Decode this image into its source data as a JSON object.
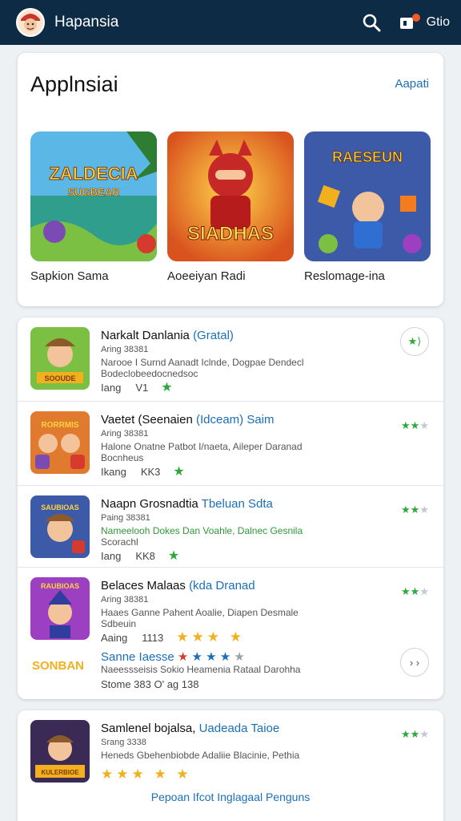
{
  "header": {
    "title": "Hapansia",
    "action_label": "Gtio"
  },
  "featured": {
    "title": "Applnsiai",
    "link": "Aapati",
    "items": [
      {
        "label": "Sapkion Sama",
        "art": "ZALDECIA SUGBEAR"
      },
      {
        "label": "Aoeeiyan Radi",
        "art": "SIADHAS"
      },
      {
        "label": "Reslomage-ina",
        "art": "RAESEUN"
      }
    ]
  },
  "list": {
    "rows": [
      {
        "title": "Narkalt Danlania",
        "accent": "(Gratal)",
        "meta": "Aring 38381",
        "desc1": "Narooe I Surnd Aanadt Iclnde, Dogpae Dendecl",
        "desc2": "Bodeclobeedocnedsoc",
        "foot1": "Iang",
        "foot2": "V1",
        "rating": "★",
        "icon": "SOOUDE"
      },
      {
        "title": "Vaetet (Seenaien",
        "accent": "(Idceam) Saim",
        "meta": "Aring 38381",
        "desc1": "Halone Onatne Patbot I/naeta, Aileper Daranad",
        "desc2": "Bocnheus",
        "foot1": "Ikang",
        "foot2": "KK3",
        "rating": "★",
        "icon": "RORRMIS"
      },
      {
        "title": "Naapn Grosnadtia",
        "accent": "Tbeluan Sdta",
        "meta": "Paing 38381",
        "desc1": "Nameelooh Dokes Dan Voahle, Dalnec Gesnila",
        "desc2": "Scorachl",
        "foot1": "Iang",
        "foot2": "KK8",
        "rating": "★",
        "icon": "SAUBIOAS"
      },
      {
        "title": "Belaces Malaas",
        "accent": "(kda Dranad",
        "meta": "Aring 38381",
        "desc1": "Haaes Ganne Pahent Aoalie, Diapen Desmale",
        "desc2": "Sdbeuin",
        "foot1": "Aaing",
        "foot2": "1113",
        "rating": "★★★ ★",
        "icon": "RAUBIOAS"
      }
    ],
    "extra": {
      "title": "Sanne Iaesse",
      "desc": "Naeessseisis Sokio Heamenia Rataal Darohha",
      "foot": "Stome 383 O' ag 138",
      "logo": "SONBAN"
    },
    "last": {
      "title": "Samlenel bojalsa,",
      "accent": "Uadeada Taioe",
      "meta": "Srang 3338",
      "desc": "Heneds Gbehenbiobde Adaliie Blacinie, Pethia",
      "stars": "★★★ ★ ★",
      "icon": "KULERBIOE"
    },
    "bottom_link": "Pepoan Ifcot Inglagaal Penguns"
  },
  "colors": {
    "header_bg": "#0d2b45",
    "accent_blue": "#1a6fb8",
    "rating_green": "#2ea83a",
    "rating_gold": "#f2b01e"
  }
}
